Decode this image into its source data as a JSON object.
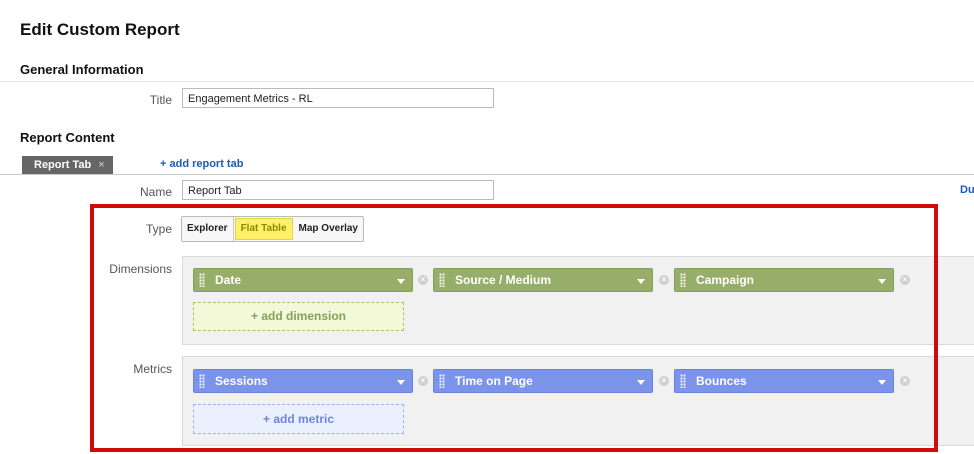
{
  "page": {
    "title": "Edit Custom Report"
  },
  "general": {
    "heading": "General Information",
    "title_label": "Title",
    "title_value": "Engagement Metrics - RL"
  },
  "content": {
    "heading": "Report Content",
    "tab_label": "Report Tab",
    "tab_close": "×",
    "add_tab": "+ add report tab",
    "name_label": "Name",
    "name_value": "Report Tab",
    "right_cut_text": "Du"
  },
  "type": {
    "label": "Type",
    "options": [
      "Explorer",
      "Flat Table",
      "Map Overlay"
    ],
    "selected": "Flat Table"
  },
  "dimensions": {
    "label": "Dimensions",
    "items": [
      "Date",
      "Source / Medium",
      "Campaign"
    ],
    "add": "+ add dimension"
  },
  "metrics": {
    "label": "Metrics",
    "items": [
      "Sessions",
      "Time on Page",
      "Bounces"
    ],
    "add": "+ add metric"
  },
  "remove_glyph": "×",
  "colors": {
    "dimension": "#97ae6a",
    "metric": "#7b93e8",
    "highlight": "#d10a0a",
    "selected": "#fff06a"
  }
}
